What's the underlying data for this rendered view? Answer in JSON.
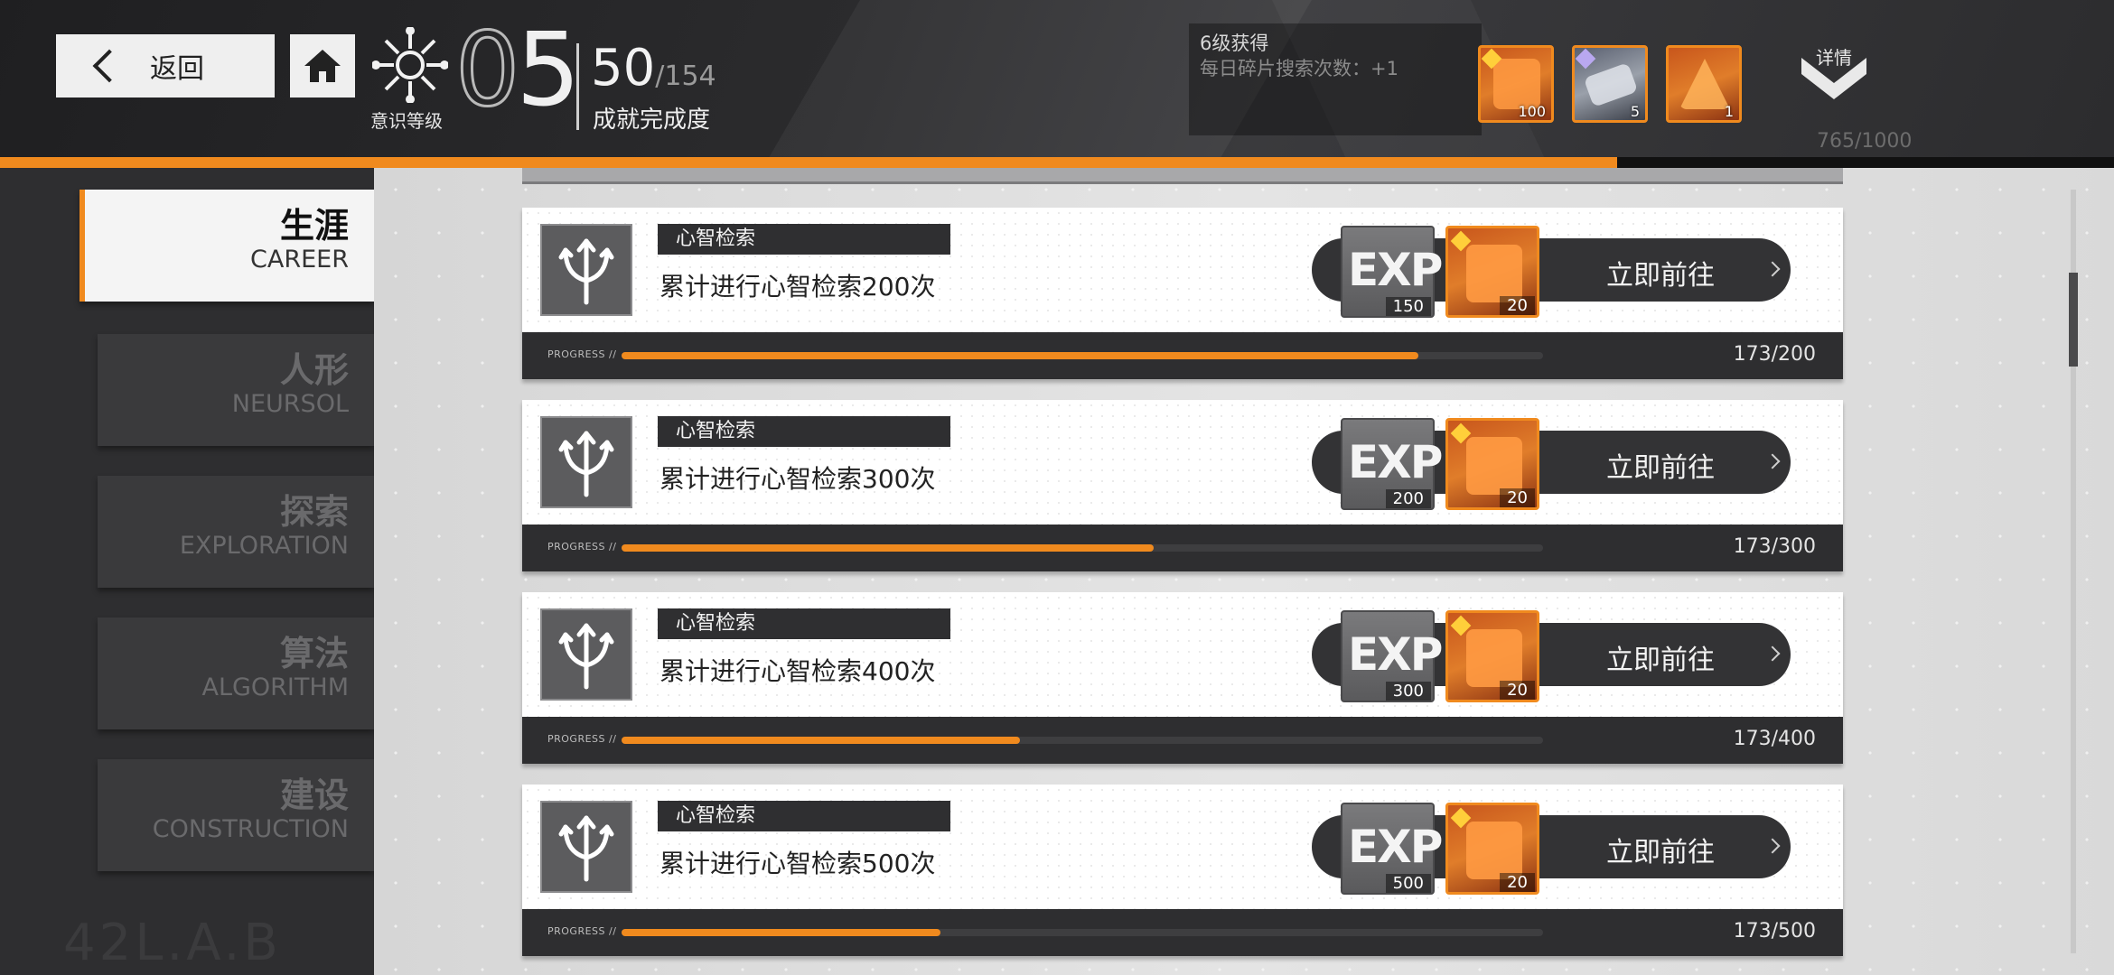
{
  "header": {
    "back_label": "返回",
    "level_label": "意识等级",
    "level_tens": "0",
    "level_ones": "5",
    "achievement_count": "50",
    "achievement_total": "/154",
    "achievement_label": "成就完成度",
    "reward_title": "6级获得",
    "reward_desc": "每日碎片搜索次数：+1",
    "rewards": [
      {
        "name": "orange-fragment",
        "qty": "100"
      },
      {
        "name": "ticket",
        "qty": "5"
      },
      {
        "name": "crystal",
        "qty": "1"
      }
    ],
    "details_label": "详情",
    "exp_progress": "765/1000",
    "exp_fraction": 0.765
  },
  "sidebar": {
    "tabs": [
      {
        "cn": "生涯",
        "en": "CAREER",
        "active": true
      },
      {
        "cn": "人形",
        "en": "NEURSOL",
        "active": false
      },
      {
        "cn": "探索",
        "en": "EXPLORATION",
        "active": false
      },
      {
        "cn": "算法",
        "en": "ALGORITHM",
        "active": false
      },
      {
        "cn": "建设",
        "en": "CONSTRUCTION",
        "active": false
      }
    ],
    "watermark": "42L.A.B"
  },
  "achievements": [
    {
      "category": "心智检索",
      "title": "累计进行心智检索200次",
      "exp_label": "EXP",
      "exp": "150",
      "fragments": "20",
      "goto_label": "立即前往",
      "progress_label": "PROGRESS //",
      "progress_text": "173/200",
      "progress": 0.865
    },
    {
      "category": "心智检索",
      "title": "累计进行心智检索300次",
      "exp_label": "EXP",
      "exp": "200",
      "fragments": "20",
      "goto_label": "立即前往",
      "progress_label": "PROGRESS //",
      "progress_text": "173/300",
      "progress": 0.577
    },
    {
      "category": "心智检索",
      "title": "累计进行心智检索400次",
      "exp_label": "EXP",
      "exp": "300",
      "fragments": "20",
      "goto_label": "立即前往",
      "progress_label": "PROGRESS //",
      "progress_text": "173/400",
      "progress": 0.4325
    },
    {
      "category": "心智检索",
      "title": "累计进行心智检索500次",
      "exp_label": "EXP",
      "exp": "500",
      "fragments": "20",
      "goto_label": "立即前往",
      "progress_label": "PROGRESS //",
      "progress_text": "173/500",
      "progress": 0.346
    }
  ],
  "colors": {
    "accent": "#f08a1e",
    "dark": "#2e2e30"
  }
}
